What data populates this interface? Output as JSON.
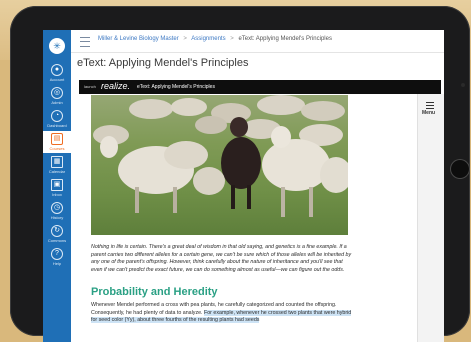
{
  "sidebar": {
    "logo_icon": "asterisk-logo",
    "items": [
      {
        "label": "Account",
        "icon": "account-icon"
      },
      {
        "label": "Admin",
        "icon": "admin-icon"
      },
      {
        "label": "Dashboard",
        "icon": "dashboard-icon"
      },
      {
        "label": "Courses",
        "icon": "courses-icon",
        "active": true
      },
      {
        "label": "Calendar",
        "icon": "calendar-icon"
      },
      {
        "label": "Inbox",
        "icon": "inbox-icon"
      },
      {
        "label": "History",
        "icon": "history-icon"
      },
      {
        "label": "Commons",
        "icon": "commons-icon"
      },
      {
        "label": "Help",
        "icon": "help-icon"
      }
    ]
  },
  "breadcrumb": {
    "course": "Miller & Levine Biology Master",
    "section": "Assignments",
    "current": "eText: Applying Mendel's Principles",
    "separator": ">"
  },
  "page_title": "eText: Applying Mendel's Principles",
  "ebook_bar": {
    "launch_label": "launch",
    "brand": "realize.",
    "title": "eText: Applying Mendel's Principles"
  },
  "right_panel": {
    "menu_label": "Menu"
  },
  "content": {
    "intro_paragraph": "Nothing in life is certain. There's a great deal of wisdom in that old saying, and genetics is a fine example. If a parent carries two different alleles for a certain gene, we can't be sure which of those alleles will be inherited by any one of the parent's offspring. However, think carefully about the nature of inheritance and you'll see that even if we can't predict the exact future, we can do something almost as useful—we can figure out the odds.",
    "section_heading": "Probability and Heredity",
    "section_text_before": "Whenever Mendel performed a cross with pea plants, he carefully categorized and counted the offspring. Consequently, he had plenty of data to analyze.",
    "section_text_highlight": "For example, whenever he crossed two plants that were hybrid for seed color (Yy), about three fourths of the resulting plants had seeds",
    "section_text_after": ""
  },
  "colors": {
    "sidebar": "#1f6fb6",
    "active_nav": "#ef6c21",
    "heading": "#2aa084",
    "ebook_bar": "#0e0e0e"
  }
}
